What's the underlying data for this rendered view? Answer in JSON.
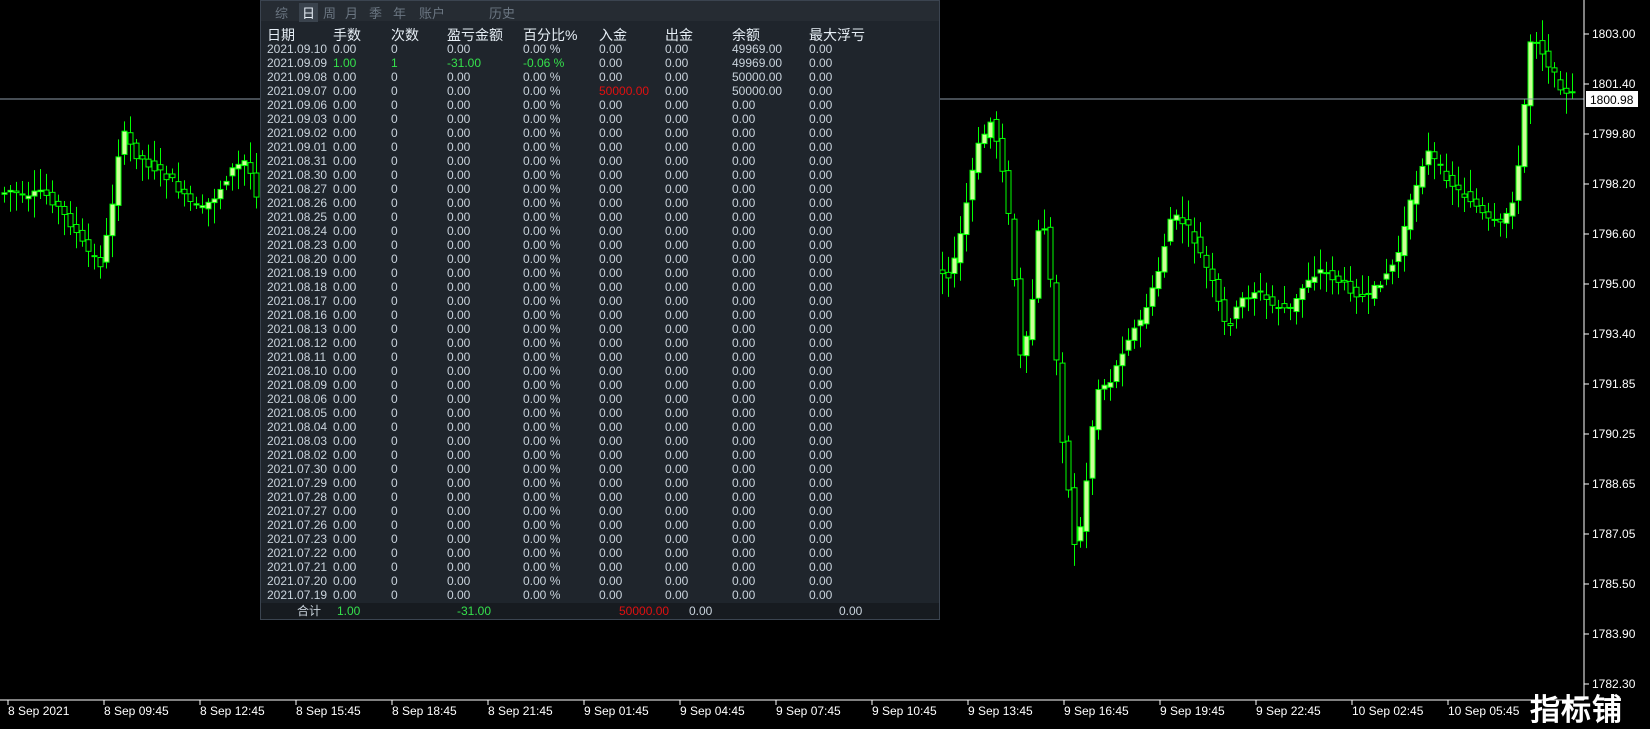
{
  "chart": {
    "price_axis_labels": [
      "1803.00",
      "1801.40",
      "1799.80",
      "1798.20",
      "1796.60",
      "1795.00",
      "1793.40",
      "1791.85",
      "1790.25",
      "1788.65",
      "1787.05",
      "1785.50",
      "1783.90",
      "1782.30"
    ],
    "current_price": "1800.98",
    "time_labels": [
      "8 Sep 2021",
      "8 Sep 09:45",
      "8 Sep 12:45",
      "8 Sep 15:45",
      "8 Sep 18:45",
      "8 Sep 21:45",
      "9 Sep 01:45",
      "9 Sep 04:45",
      "9 Sep 07:45",
      "9 Sep 10:45",
      "9 Sep 13:45",
      "9 Sep 16:45",
      "9 Sep 19:45",
      "9 Sep 22:45",
      "10 Sep 02:45",
      "10 Sep 05:45"
    ],
    "colors": {
      "candle": "#00ff00",
      "bull_body": "#ccff99",
      "bear_body": "#000000",
      "axis": "#ffffff",
      "price_line": "#8c9aa8"
    }
  },
  "panel": {
    "tabs": [
      {
        "label": "综",
        "active": false
      },
      {
        "label": "日",
        "active": true
      },
      {
        "label": "周",
        "active": false
      },
      {
        "label": "月",
        "active": false
      },
      {
        "label": "季",
        "active": false
      },
      {
        "label": "年",
        "active": false
      },
      {
        "label": "账户",
        "active": false
      },
      {
        "label": "历史",
        "active": false
      }
    ],
    "columns": [
      "日期",
      "手数",
      "次数",
      "盈亏金额",
      "百分比%",
      "入金",
      "出金",
      "余额",
      "最大浮亏"
    ],
    "rows": [
      [
        "2021.09.10",
        "0.00",
        "0",
        "0.00",
        "0.00 %",
        "0.00",
        "0.00",
        "49969.00",
        "0.00"
      ],
      [
        "2021.09.09",
        "1.00",
        "1",
        "-31.00",
        "-0.06 %",
        "0.00",
        "0.00",
        "49969.00",
        "0.00"
      ],
      [
        "2021.09.08",
        "0.00",
        "0",
        "0.00",
        "0.00 %",
        "0.00",
        "0.00",
        "50000.00",
        "0.00"
      ],
      [
        "2021.09.07",
        "0.00",
        "0",
        "0.00",
        "0.00 %",
        "50000.00",
        "0.00",
        "50000.00",
        "0.00"
      ],
      [
        "2021.09.06",
        "0.00",
        "0",
        "0.00",
        "0.00 %",
        "0.00",
        "0.00",
        "0.00",
        "0.00"
      ],
      [
        "2021.09.03",
        "0.00",
        "0",
        "0.00",
        "0.00 %",
        "0.00",
        "0.00",
        "0.00",
        "0.00"
      ],
      [
        "2021.09.02",
        "0.00",
        "0",
        "0.00",
        "0.00 %",
        "0.00",
        "0.00",
        "0.00",
        "0.00"
      ],
      [
        "2021.09.01",
        "0.00",
        "0",
        "0.00",
        "0.00 %",
        "0.00",
        "0.00",
        "0.00",
        "0.00"
      ],
      [
        "2021.08.31",
        "0.00",
        "0",
        "0.00",
        "0.00 %",
        "0.00",
        "0.00",
        "0.00",
        "0.00"
      ],
      [
        "2021.08.30",
        "0.00",
        "0",
        "0.00",
        "0.00 %",
        "0.00",
        "0.00",
        "0.00",
        "0.00"
      ],
      [
        "2021.08.27",
        "0.00",
        "0",
        "0.00",
        "0.00 %",
        "0.00",
        "0.00",
        "0.00",
        "0.00"
      ],
      [
        "2021.08.26",
        "0.00",
        "0",
        "0.00",
        "0.00 %",
        "0.00",
        "0.00",
        "0.00",
        "0.00"
      ],
      [
        "2021.08.25",
        "0.00",
        "0",
        "0.00",
        "0.00 %",
        "0.00",
        "0.00",
        "0.00",
        "0.00"
      ],
      [
        "2021.08.24",
        "0.00",
        "0",
        "0.00",
        "0.00 %",
        "0.00",
        "0.00",
        "0.00",
        "0.00"
      ],
      [
        "2021.08.23",
        "0.00",
        "0",
        "0.00",
        "0.00 %",
        "0.00",
        "0.00",
        "0.00",
        "0.00"
      ],
      [
        "2021.08.20",
        "0.00",
        "0",
        "0.00",
        "0.00 %",
        "0.00",
        "0.00",
        "0.00",
        "0.00"
      ],
      [
        "2021.08.19",
        "0.00",
        "0",
        "0.00",
        "0.00 %",
        "0.00",
        "0.00",
        "0.00",
        "0.00"
      ],
      [
        "2021.08.18",
        "0.00",
        "0",
        "0.00",
        "0.00 %",
        "0.00",
        "0.00",
        "0.00",
        "0.00"
      ],
      [
        "2021.08.17",
        "0.00",
        "0",
        "0.00",
        "0.00 %",
        "0.00",
        "0.00",
        "0.00",
        "0.00"
      ],
      [
        "2021.08.16",
        "0.00",
        "0",
        "0.00",
        "0.00 %",
        "0.00",
        "0.00",
        "0.00",
        "0.00"
      ],
      [
        "2021.08.13",
        "0.00",
        "0",
        "0.00",
        "0.00 %",
        "0.00",
        "0.00",
        "0.00",
        "0.00"
      ],
      [
        "2021.08.12",
        "0.00",
        "0",
        "0.00",
        "0.00 %",
        "0.00",
        "0.00",
        "0.00",
        "0.00"
      ],
      [
        "2021.08.11",
        "0.00",
        "0",
        "0.00",
        "0.00 %",
        "0.00",
        "0.00",
        "0.00",
        "0.00"
      ],
      [
        "2021.08.10",
        "0.00",
        "0",
        "0.00",
        "0.00 %",
        "0.00",
        "0.00",
        "0.00",
        "0.00"
      ],
      [
        "2021.08.09",
        "0.00",
        "0",
        "0.00",
        "0.00 %",
        "0.00",
        "0.00",
        "0.00",
        "0.00"
      ],
      [
        "2021.08.06",
        "0.00",
        "0",
        "0.00",
        "0.00 %",
        "0.00",
        "0.00",
        "0.00",
        "0.00"
      ],
      [
        "2021.08.05",
        "0.00",
        "0",
        "0.00",
        "0.00 %",
        "0.00",
        "0.00",
        "0.00",
        "0.00"
      ],
      [
        "2021.08.04",
        "0.00",
        "0",
        "0.00",
        "0.00 %",
        "0.00",
        "0.00",
        "0.00",
        "0.00"
      ],
      [
        "2021.08.03",
        "0.00",
        "0",
        "0.00",
        "0.00 %",
        "0.00",
        "0.00",
        "0.00",
        "0.00"
      ],
      [
        "2021.08.02",
        "0.00",
        "0",
        "0.00",
        "0.00 %",
        "0.00",
        "0.00",
        "0.00",
        "0.00"
      ],
      [
        "2021.07.30",
        "0.00",
        "0",
        "0.00",
        "0.00 %",
        "0.00",
        "0.00",
        "0.00",
        "0.00"
      ],
      [
        "2021.07.29",
        "0.00",
        "0",
        "0.00",
        "0.00 %",
        "0.00",
        "0.00",
        "0.00",
        "0.00"
      ],
      [
        "2021.07.28",
        "0.00",
        "0",
        "0.00",
        "0.00 %",
        "0.00",
        "0.00",
        "0.00",
        "0.00"
      ],
      [
        "2021.07.27",
        "0.00",
        "0",
        "0.00",
        "0.00 %",
        "0.00",
        "0.00",
        "0.00",
        "0.00"
      ],
      [
        "2021.07.26",
        "0.00",
        "0",
        "0.00",
        "0.00 %",
        "0.00",
        "0.00",
        "0.00",
        "0.00"
      ],
      [
        "2021.07.23",
        "0.00",
        "0",
        "0.00",
        "0.00 %",
        "0.00",
        "0.00",
        "0.00",
        "0.00"
      ],
      [
        "2021.07.22",
        "0.00",
        "0",
        "0.00",
        "0.00 %",
        "0.00",
        "0.00",
        "0.00",
        "0.00"
      ],
      [
        "2021.07.21",
        "0.00",
        "0",
        "0.00",
        "0.00 %",
        "0.00",
        "0.00",
        "0.00",
        "0.00"
      ],
      [
        "2021.07.20",
        "0.00",
        "0",
        "0.00",
        "0.00 %",
        "0.00",
        "0.00",
        "0.00",
        "0.00"
      ],
      [
        "2021.07.19",
        "0.00",
        "0",
        "0.00",
        "0.00 %",
        "0.00",
        "0.00",
        "0.00",
        "0.00"
      ]
    ],
    "highlight_row": 1,
    "deposit_row": 3,
    "footer": {
      "label": "合计",
      "lots": "1.00",
      "profit": "-31.00",
      "deposit": "50000.00",
      "withdraw": "0.00",
      "max_drawdown": "0.00"
    },
    "colors": {
      "profit_positive": "#35e04c",
      "deposit": "#e01010"
    }
  },
  "watermark": "指标铺"
}
